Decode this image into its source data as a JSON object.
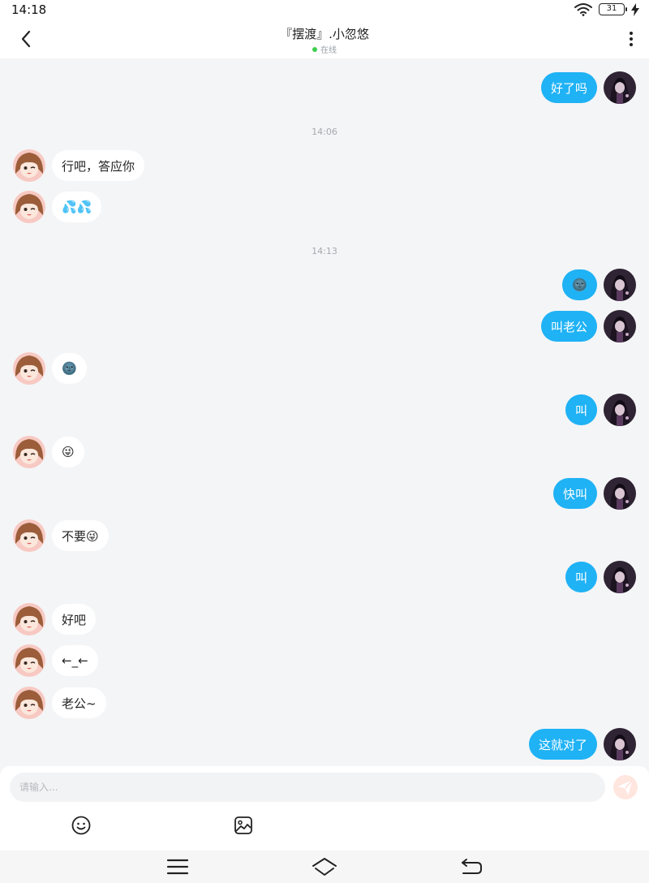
{
  "status_bar": {
    "time": "14:18",
    "battery": "31"
  },
  "header": {
    "title": "『摆渡』.小忽悠",
    "online_status": "在线"
  },
  "timestamps": [
    "14:06",
    "14:13"
  ],
  "messages": [
    {
      "side": "right",
      "text": "好了吗"
    },
    {
      "side": "left",
      "text": "行吧，答应你"
    },
    {
      "side": "left",
      "text": "💦💦"
    },
    {
      "side": "right",
      "text": "🌚"
    },
    {
      "side": "right",
      "text": "叫老公"
    },
    {
      "side": "left",
      "text": "🌚"
    },
    {
      "side": "right",
      "text": "叫"
    },
    {
      "side": "left",
      "text": "😜"
    },
    {
      "side": "right",
      "text": "快叫"
    },
    {
      "side": "left",
      "text": "不要😜"
    },
    {
      "side": "right",
      "text": "叫"
    },
    {
      "side": "left",
      "text": "好吧"
    },
    {
      "side": "left",
      "text": "←_←"
    },
    {
      "side": "left",
      "text": "老公~"
    },
    {
      "side": "right",
      "text": "这就对了"
    }
  ],
  "input": {
    "placeholder": "请输入..."
  },
  "icons": {
    "back": "back-arrow-icon",
    "more": "more-vertical-icon",
    "send": "send-icon",
    "emoji": "emoji-icon",
    "image": "image-icon",
    "menu": "menu-icon",
    "home": "home-icon",
    "return": "return-icon"
  },
  "colors": {
    "sent_bubble": "#1fb2f5",
    "received_bubble": "#ffffff",
    "online_dot": "#3ccf4e",
    "send_button": "#ffe6df"
  }
}
